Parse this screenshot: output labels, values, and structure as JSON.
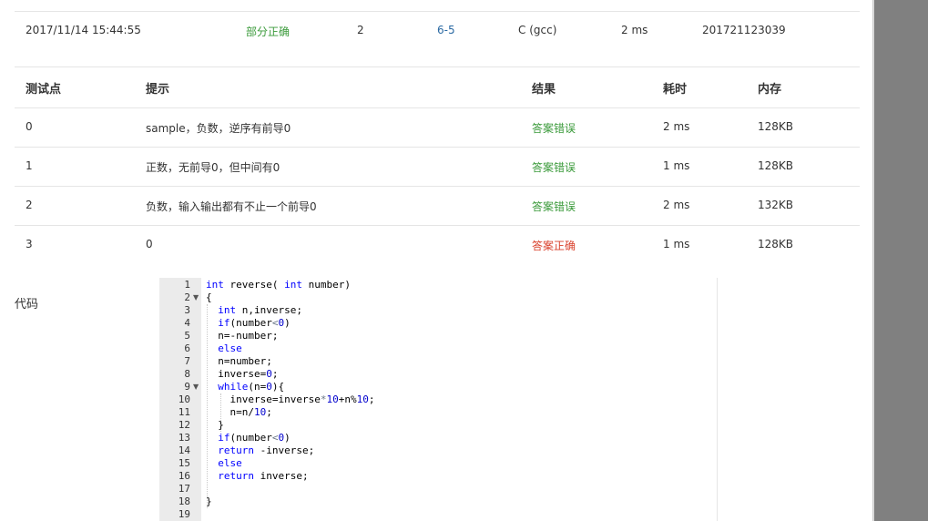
{
  "summary": {
    "time": "2017/11/14 15:44:55",
    "status": "部分正确",
    "score": "2",
    "problem": "6-5",
    "compiler": "C (gcc)",
    "elapsed": "2 ms",
    "user": "201721123039"
  },
  "table": {
    "headers": {
      "case": "测试点",
      "hint": "提示",
      "result": "结果",
      "time": "耗时",
      "memory": "内存"
    },
    "rows": [
      {
        "case": "0",
        "hint": "sample，负数，逆序有前导0",
        "result": "答案错误",
        "time": "2 ms",
        "memory": "128KB"
      },
      {
        "case": "1",
        "hint": "正数，无前导0，但中间有0",
        "result": "答案错误",
        "time": "1 ms",
        "memory": "128KB"
      },
      {
        "case": "2",
        "hint": "负数，输入输出都有不止一个前导0",
        "result": "答案错误",
        "time": "2 ms",
        "memory": "132KB"
      },
      {
        "case": "3",
        "hint": "0",
        "result": "答案正确",
        "time": "1 ms",
        "memory": "128KB"
      }
    ]
  },
  "code_label": "代码",
  "code": {
    "line_numbers": [
      "1",
      "2",
      "3",
      "4",
      "5",
      "6",
      "7",
      "8",
      "9",
      "10",
      "11",
      "12",
      "13",
      "14",
      "15",
      "16",
      "17",
      "18",
      "19"
    ],
    "fold_lines": [
      "2",
      "9"
    ]
  },
  "colors": {
    "status_partial": "#3a9a3a",
    "wrong_answer": "#3a9a3a",
    "accepted": "#d9412c",
    "link": "#2b6aa3",
    "keyword": "#0000ff",
    "number": "#0000cd"
  }
}
